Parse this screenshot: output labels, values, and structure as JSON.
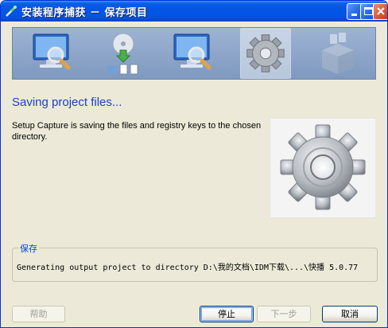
{
  "window": {
    "title": "安装程序捕获 － 保存项目"
  },
  "titlebar_buttons": [
    "minimize-icon",
    "maximize-icon",
    "close-icon"
  ],
  "banner": {
    "steps": [
      {
        "icon": "monitor-magnifier-icon",
        "active": false
      },
      {
        "icon": "disc-install-icon",
        "active": false
      },
      {
        "icon": "monitor-magnifier-icon",
        "active": false
      },
      {
        "icon": "gear-icon",
        "active": true
      },
      {
        "icon": "package-box-icon",
        "active": false
      }
    ]
  },
  "main": {
    "heading": "Saving project files...",
    "description": "Setup Capture is saving the files and registry keys to the chosen directory."
  },
  "group": {
    "title": "保存",
    "status_line": "Generating output project to directory D:\\我的文档\\IDM下载\\...\\快播 5.0.77"
  },
  "buttons": {
    "help": "帮助",
    "stop": "停止",
    "next": "下一步",
    "cancel": "取消"
  },
  "colors": {
    "heading": "#1b3fc9",
    "titlebar": "#0055e5",
    "window_bg": "#ece9d8"
  }
}
